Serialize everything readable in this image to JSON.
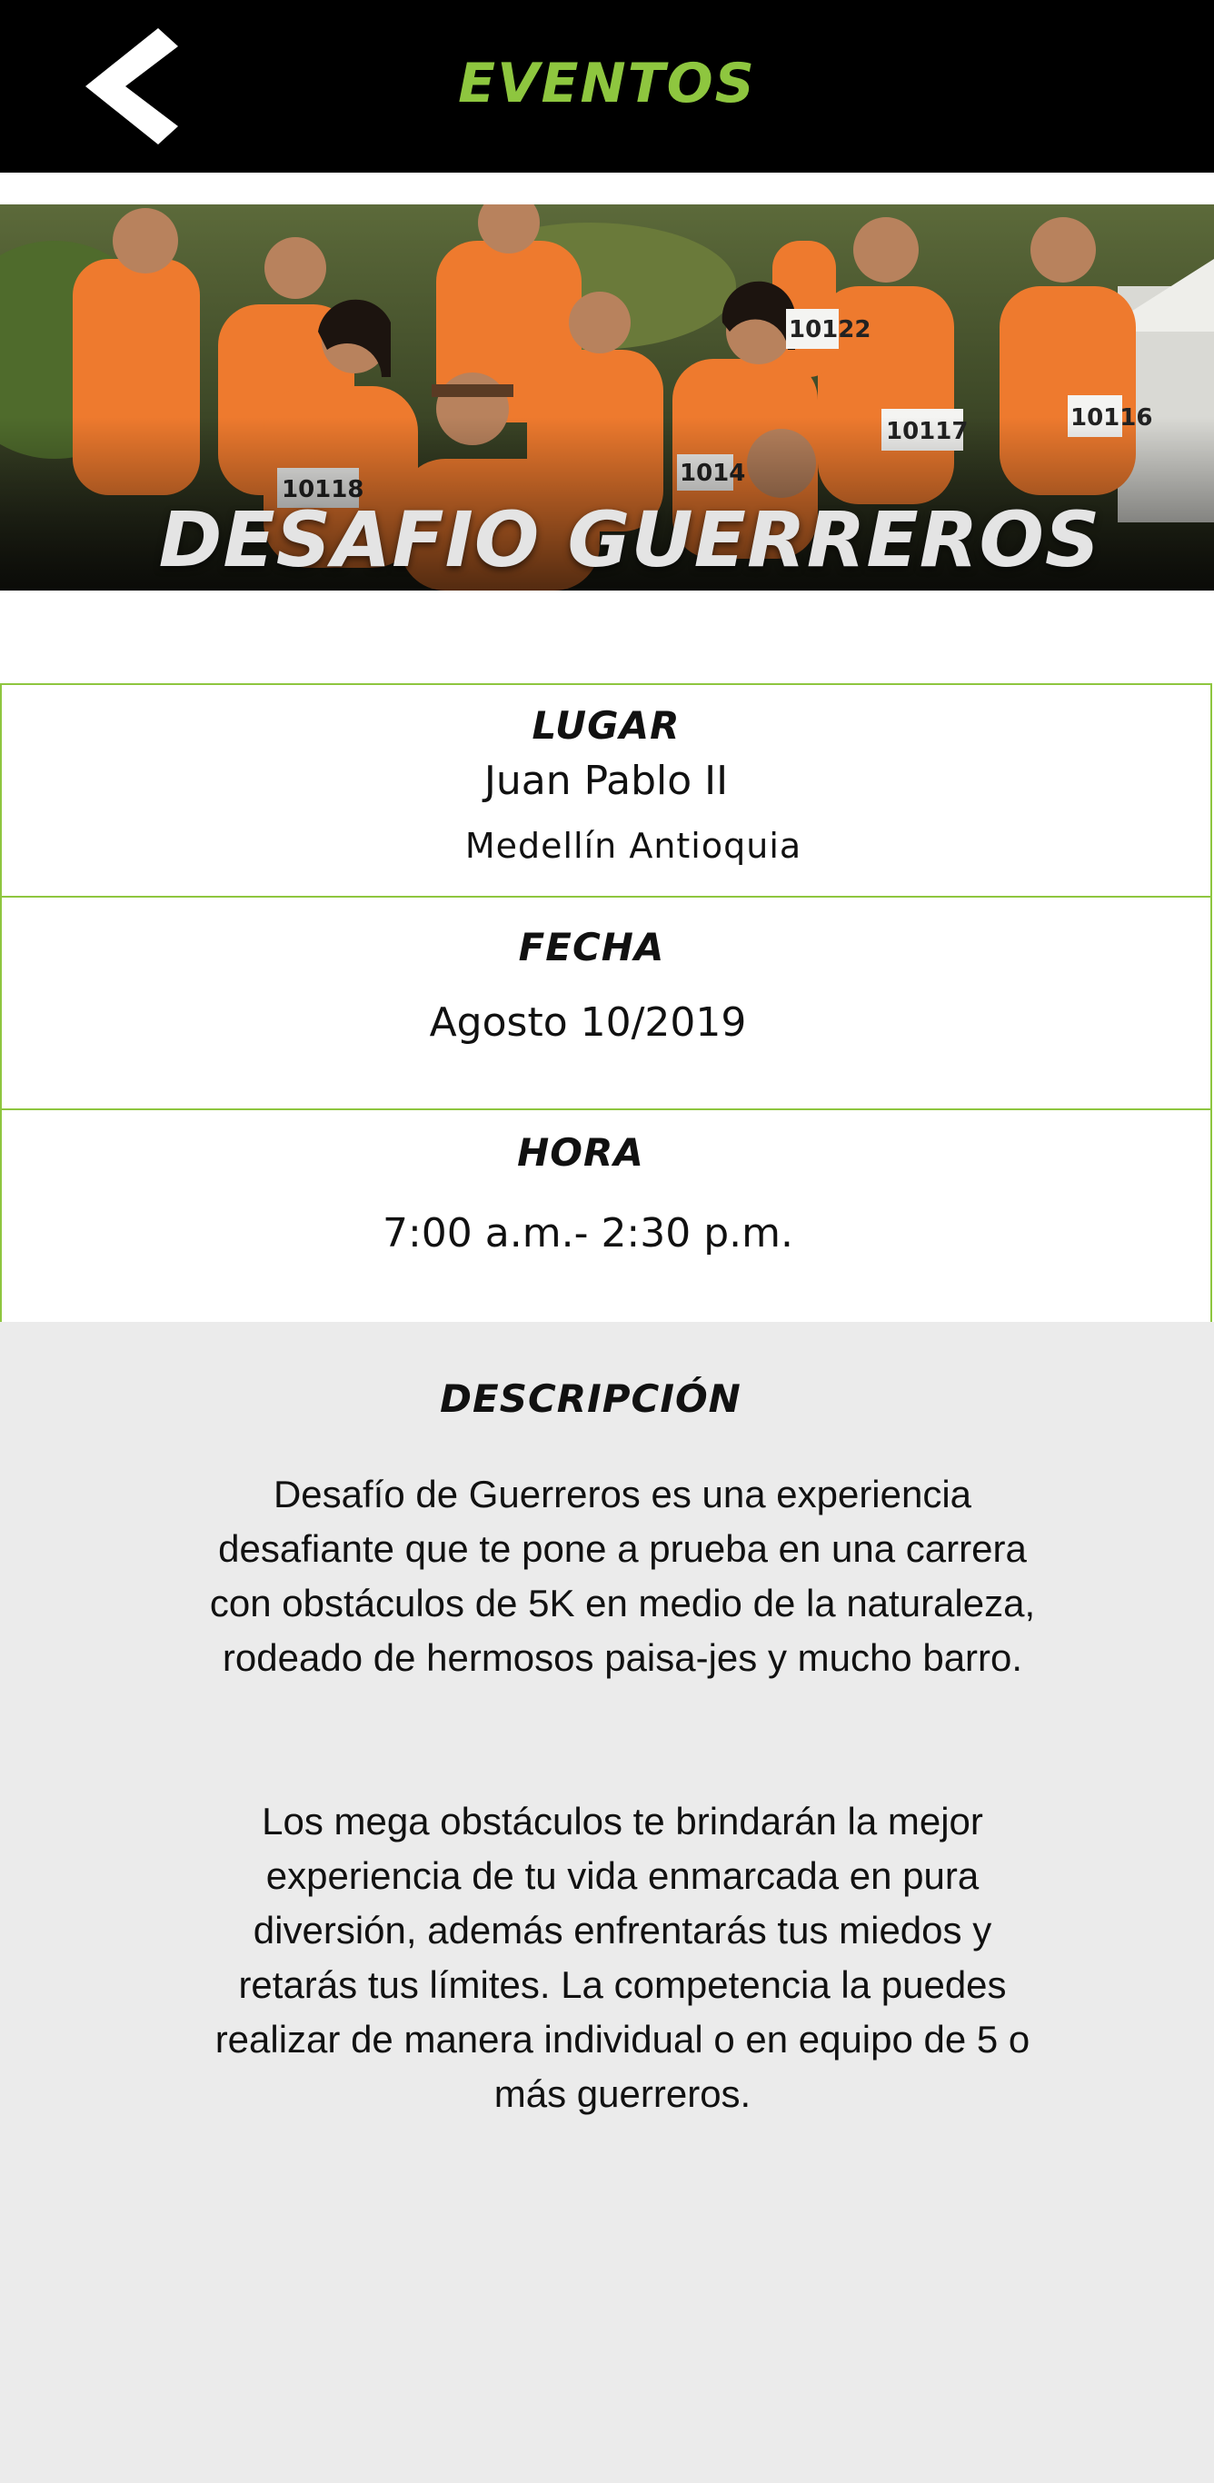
{
  "header": {
    "title": "EVENTOS",
    "back_icon": "chevron-left-icon",
    "background": "#000000",
    "accent": "#8ec63f"
  },
  "hero": {
    "title": "DESAFIO GUERREROS",
    "bib_numbers": [
      "10122",
      "10117",
      "10116",
      "10118",
      "1014"
    ]
  },
  "details": {
    "place": {
      "label": "LUGAR",
      "value": "Juan Pablo II",
      "sub": "Medellín Antioquia"
    },
    "date": {
      "label": "FECHA",
      "value": "Agosto 10/2019"
    },
    "time": {
      "label": "HORA",
      "value": "7:00 a.m.- 2:30 p.m."
    }
  },
  "description": {
    "title": "DESCRIPCIÓN",
    "paragraphs": [
      "Desafío de Guerreros es una experiencia desafiante que te pone a prueba en una carrera con obstáculos de 5K en medio de la naturaleza, rodeado de hermosos paisa-jes y mucho barro.",
      "Los mega obstáculos te brindarán la mejor experiencia de tu vida enmarcada en pura diversión, además enfrentarás tus miedos y retarás tus límites. La competencia la puedes realizar de manera individual o en equipo de 5 o más guerreros."
    ]
  },
  "colors": {
    "border": "#8ec63f",
    "description_bg": "#ebebeb",
    "shirts": "#ee7a2e"
  }
}
